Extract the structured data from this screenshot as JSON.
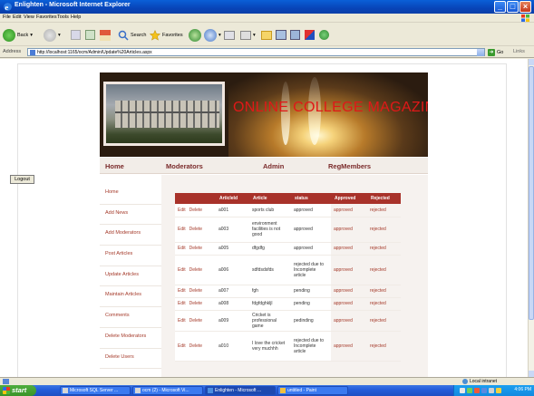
{
  "window": {
    "title": "Enlighten - Microsoft Internet Explorer"
  },
  "menubar": {
    "items": [
      "File",
      "Edit",
      "View",
      "Favorites",
      "Tools",
      "Help"
    ]
  },
  "toolbar": {
    "back": "Back",
    "search": "Search",
    "favorites": "Favorites"
  },
  "address": {
    "label": "Address",
    "url": "http://localhost:1165/ocm/Admin/Update%20Articles.aspx",
    "go": "Go",
    "links": "Links"
  },
  "banner": {
    "title": "ONLINE COLLEGE MAGAZINE"
  },
  "nav": {
    "home": "Home",
    "moderators": "Moderators",
    "admin": "Admin",
    "regmembers": "RegMembers"
  },
  "logout": "Logout",
  "sidemenu": [
    "Home",
    "Add News",
    "Add Moderators",
    "Post Articles",
    "Update Articles",
    "Maintain Articles",
    "Comments",
    "Delete Moderators",
    "Delete Users"
  ],
  "table": {
    "headers": [
      "",
      "ArticleId",
      "Article",
      "status",
      "Approved",
      "Rejected"
    ],
    "edit": "Edit",
    "delete": "Delete",
    "rows": [
      {
        "id": "a001",
        "article": "sports club",
        "status": "approved",
        "approved": "approved",
        "rejected": "rejected"
      },
      {
        "id": "a003",
        "article": "environment facilities is not good",
        "status": "approved",
        "approved": "approved",
        "rejected": "rejected"
      },
      {
        "id": "a005",
        "article": "dfgdfg",
        "status": "approved",
        "approved": "approved",
        "rejected": "rejected"
      },
      {
        "id": "a006",
        "article": "sdfdsdsfds",
        "status": "rejected due to Incomplete article",
        "approved": "approved",
        "rejected": "rejected"
      },
      {
        "id": "a007",
        "article": "fgh",
        "status": "pending",
        "approved": "approved",
        "rejected": "rejected"
      },
      {
        "id": "a008",
        "article": "fdgfdghkljl",
        "status": "pending",
        "approved": "approved",
        "rejected": "rejected"
      },
      {
        "id": "a009",
        "article": "Cricket is professional game",
        "status": "pedinding",
        "approved": "approved",
        "rejected": "rejected"
      },
      {
        "id": "a010",
        "article": "I love the cricket very muchhh",
        "status": "rejected due to Incomplete article",
        "approved": "approved",
        "rejected": "rejected"
      }
    ]
  },
  "statusbar": {
    "zone": "Local intranet"
  },
  "taskbar": {
    "start": "start",
    "tasks": [
      "Microsoft SQL Server ...",
      "ocm (2) - Microsoft Vi...",
      "Enlighten - Microsoft ...",
      "untitled - Paint"
    ],
    "clock": "4:06 PM"
  },
  "colors": {
    "accent": "#a8322a",
    "link": "#a53a2a",
    "banner_text": "#e01818"
  }
}
